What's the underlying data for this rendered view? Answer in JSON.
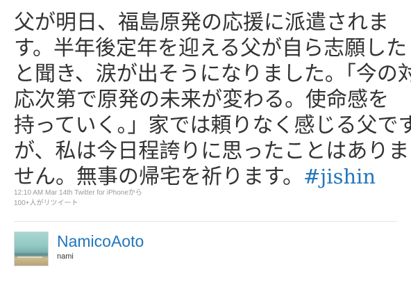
{
  "tweet": {
    "lines": [
      "父が明日、福島原発の応援に派遣されま",
      "す。半年後定年を迎える父が自ら志願した",
      "と聞き、涙が出そうになりました。「今の対",
      "応次第で原発の未来が変わる。使命感を",
      "持っていく。」家では頼りなく感じる父です",
      "が、私は今日程誇りに思ったことはありま",
      "せん。無事の帰宅を祈ります。"
    ],
    "hashtag": "#jishin"
  },
  "meta": {
    "timestamp": "12:10 AM Mar 14th",
    "source": "Twitter for iPhone",
    "source_suffix": "から",
    "retweets": "100+人がリツイート"
  },
  "author": {
    "screen_name": "NamicoAoto",
    "full_name": "nami"
  },
  "colors": {
    "link": "#2276bb",
    "text": "#333333",
    "meta": "#999999"
  }
}
